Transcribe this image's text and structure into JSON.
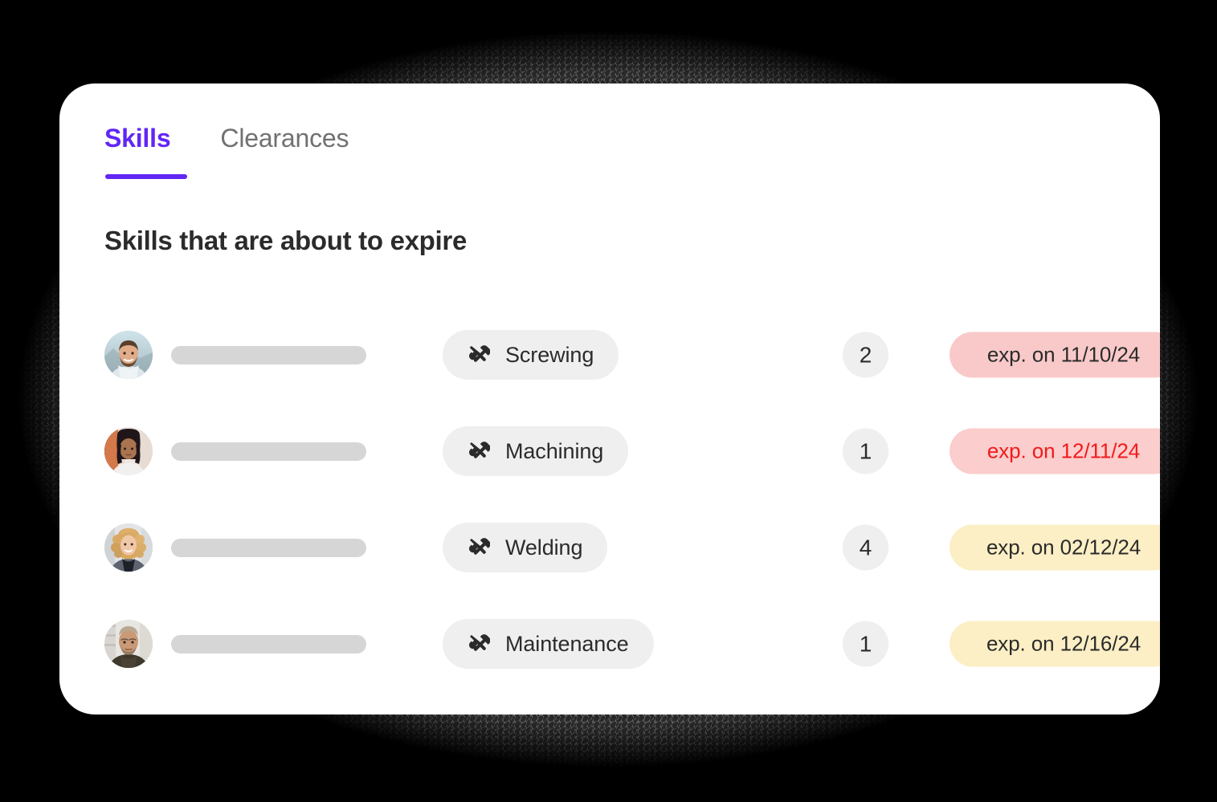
{
  "card": {
    "background_color": "#ffffff"
  },
  "tabs": [
    {
      "label": "Skills",
      "active": true,
      "accent_color": "#6226f5"
    },
    {
      "label": "Clearances",
      "active": false,
      "color": "#717171"
    }
  ],
  "section": {
    "title": "Skills that are about to expire"
  },
  "table": {
    "rows": [
      {
        "avatar": "avatar-man-beard-outdoor",
        "name_placeholder": "",
        "skill_icon": "tools-icon",
        "skill": "Screwing",
        "count": "2",
        "expiry": "exp. on 11/10/24",
        "severity": "sev-red-dark",
        "badge_bg": "#f9c9c9",
        "badge_text_color": "#2b2b2b"
      },
      {
        "avatar": "avatar-woman-dark-hair",
        "name_placeholder": "",
        "skill_icon": "tools-icon",
        "skill": "Machining",
        "count": "1",
        "expiry": "exp. on 12/11/24",
        "severity": "sev-red",
        "badge_bg": "#fbcdcd",
        "badge_text_color": "#f01b1b"
      },
      {
        "avatar": "avatar-woman-curly-blonde",
        "name_placeholder": "",
        "skill_icon": "tools-icon",
        "skill": "Welding",
        "count": "4",
        "expiry": "exp. on 02/12/24",
        "severity": "sev-amber",
        "badge_bg": "#fcefc5",
        "badge_text_color": "#2b2b2b"
      },
      {
        "avatar": "avatar-man-short-hair",
        "name_placeholder": "",
        "skill_icon": "tools-icon",
        "skill": "Maintenance",
        "count": "1",
        "expiry": "exp. on 12/16/24",
        "severity": "sev-amber",
        "badge_bg": "#fcefc5",
        "badge_text_color": "#2b2b2b"
      }
    ]
  }
}
